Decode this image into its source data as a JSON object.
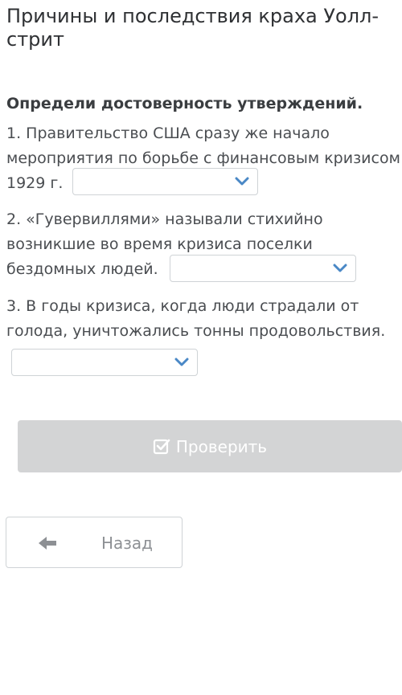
{
  "page": {
    "title": "Причины и последствия краха Уолл-стрит"
  },
  "task": {
    "instruction": "Определи достоверность утверждений."
  },
  "questions": [
    {
      "text": "1. Правительство США сразу же начало мероприятия по борьбе с финансовым кризисом 1929 г.",
      "selected": ""
    },
    {
      "text": "2. «Гувервиллями» называли стихийно возникшие во время кризиса поселки бездомных людей.",
      "selected": ""
    },
    {
      "text": "3. В годы кризиса, когда люди страдали от голода, уничтожались тонны продовольствия.",
      "selected": ""
    }
  ],
  "actions": {
    "check_label": "Проверить",
    "back_label": "Назад"
  },
  "icons": {
    "dropdown": "chevron-down-icon",
    "check": "checkbox-check-icon",
    "back": "arrow-left-icon"
  },
  "colors": {
    "chevron": "#4a88c6",
    "check_button_bg": "#d3d4d5",
    "border": "#cfd3d6",
    "text": "#4a4d51"
  }
}
